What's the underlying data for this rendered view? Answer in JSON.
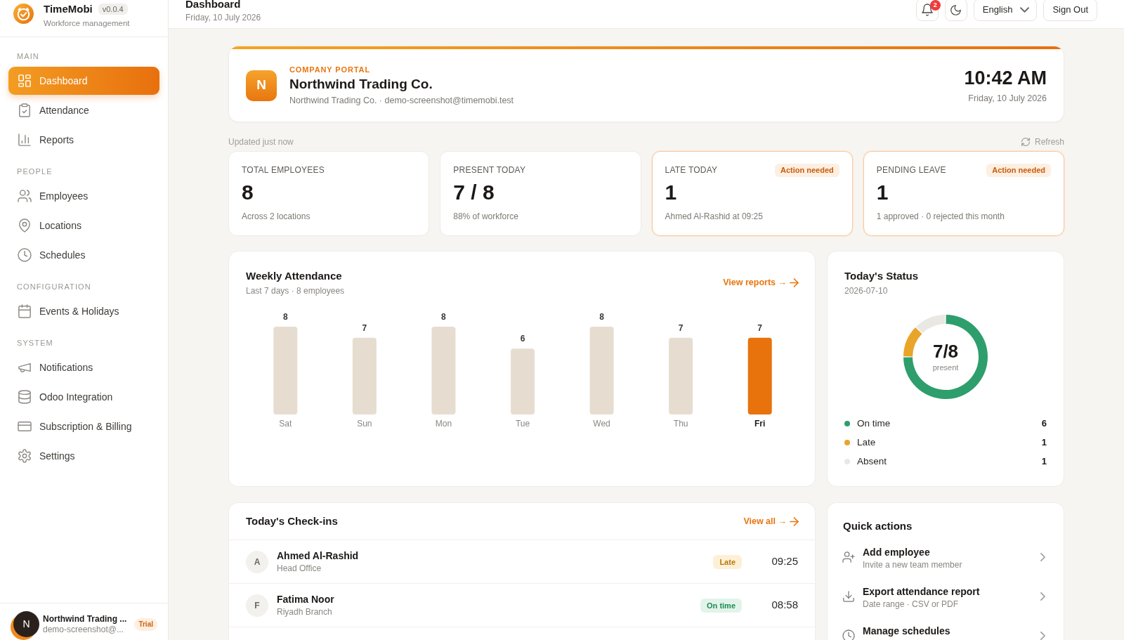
{
  "sidebar": {
    "brand": {
      "name": "TimeMobi",
      "version": "v0.0.4",
      "tagline": "Workforce management"
    },
    "sections": [
      {
        "label": "MAIN",
        "items": [
          {
            "label": "Dashboard",
            "selected": true
          },
          {
            "label": "Attendance",
            "selected": false
          },
          {
            "label": "Reports",
            "selected": false
          }
        ]
      },
      {
        "label": "PEOPLE",
        "items": [
          {
            "label": "Employees",
            "selected": false
          },
          {
            "label": "Locations",
            "selected": false
          },
          {
            "label": "Schedules",
            "selected": false
          }
        ]
      },
      {
        "label": "CONFIGURATION",
        "items": [
          {
            "label": "Events & Holidays",
            "selected": false
          }
        ]
      },
      {
        "label": "SYSTEM",
        "items": [
          {
            "label": "Notifications",
            "selected": false
          },
          {
            "label": "Odoo Integration",
            "selected": false
          },
          {
            "label": "Subscription & Billing",
            "selected": false
          },
          {
            "label": "Settings",
            "selected": false
          }
        ]
      }
    ],
    "account": {
      "initial": "N",
      "name": "Northwind Trading ...",
      "email": "demo-screenshot@...",
      "plan": "Trial"
    }
  },
  "header": {
    "title": "Dashboard",
    "date": "Friday, 10 July 2026",
    "notification_count": "2",
    "language": "English",
    "sign_out": "Sign Out"
  },
  "company": {
    "initial": "N",
    "eyebrow": "COMPANY PORTAL",
    "name": "Northwind Trading Co.",
    "details": "Northwind Trading Co. · demo-screenshot@timemobi.test",
    "time": "10:42 AM",
    "date": "Friday, 10 July 2026"
  },
  "updated": {
    "text": "Updated just now",
    "refresh": "Refresh"
  },
  "stats": [
    {
      "label": "TOTAL EMPLOYEES",
      "value": "8",
      "note": "Across 2 locations",
      "highlighted": false
    },
    {
      "label": "PRESENT TODAY",
      "value": "7 / 8",
      "note": "88% of workforce",
      "highlighted": false
    },
    {
      "label": "LATE TODAY",
      "badge": "Action needed",
      "value": "1",
      "note": "Ahmed Al-Rashid at 09:25",
      "highlighted": true
    },
    {
      "label": "PENDING LEAVE",
      "badge": "Action needed",
      "value": "1",
      "note": "1 approved · 0 rejected this month",
      "highlighted": true
    }
  ],
  "weekly_attendance": {
    "title": "Weekly Attendance",
    "subtitle": "Last 7 days · 8 employees",
    "link": "View reports →",
    "chart_data": {
      "type": "bar",
      "categories": [
        "Sat",
        "Sun",
        "Mon",
        "Tue",
        "Wed",
        "Thu",
        "Fri"
      ],
      "series": [
        {
          "color": "#e6ddd0",
          "values": [
            8,
            7,
            8,
            6,
            8,
            7,
            null
          ]
        },
        {
          "color": "#e8720c",
          "values": [
            null,
            null,
            null,
            null,
            null,
            null,
            7
          ]
        }
      ],
      "data_labels": true
    }
  },
  "todays_status": {
    "title": "Today's Status",
    "date": "2026-07-10",
    "center_value": "7/8",
    "center_label": "present",
    "chart_data": {
      "type": "donut",
      "categories": [
        "On time",
        "Late",
        "Absent"
      ],
      "values": [
        6,
        1,
        1
      ],
      "value_labels": [
        "6",
        "1",
        "1"
      ],
      "legend": "bottom"
    },
    "slices": [
      {
        "color": "#2e9e6c"
      },
      {
        "color": "#e9a42a"
      },
      {
        "color": "#eae8e3"
      }
    ]
  },
  "checkins": {
    "title": "Today's Check-ins",
    "link": "View all →",
    "rows": [
      {
        "initial": "A",
        "name": "Ahmed Al-Rashid",
        "location": "Head Office",
        "status": "Late",
        "kind": "late",
        "time": "09:25"
      },
      {
        "initial": "F",
        "name": "Fatima Noor",
        "location": "Riyadh Branch",
        "status": "On time",
        "kind": "ontime",
        "time": "08:58"
      }
    ]
  },
  "quick_actions": {
    "title": "Quick actions",
    "items": [
      {
        "title": "Add employee",
        "subtitle": "Invite a new team member"
      },
      {
        "title": "Export attendance report",
        "subtitle": "Date range · CSV or PDF"
      },
      {
        "title": "Manage schedules"
      }
    ]
  }
}
